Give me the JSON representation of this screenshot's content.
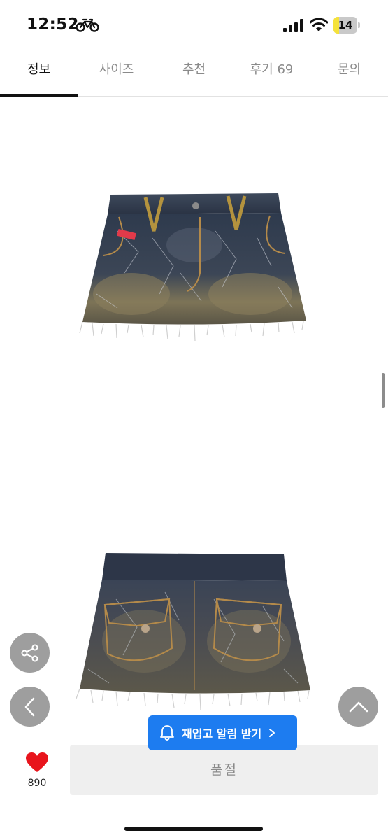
{
  "status_bar": {
    "time": "12:52",
    "battery": "14",
    "battery_level": 0.14,
    "battery_color": "#f5e23b",
    "icons": [
      "bicycle-icon",
      "cellular-signal-icon",
      "wifi-icon",
      "battery-icon"
    ]
  },
  "tabs": [
    {
      "label": "정보",
      "active": true
    },
    {
      "label": "사이즈",
      "active": false
    },
    {
      "label": "추천",
      "active": false
    },
    {
      "label": "후기 69",
      "active": false
    },
    {
      "label": "문의",
      "active": false
    }
  ],
  "product_images": [
    {
      "name": "denim-mini-skirt-front-image"
    },
    {
      "name": "denim-mini-skirt-back-image"
    }
  ],
  "floating_buttons": {
    "share_icon": "share-icon",
    "back_icon": "chevron-left-icon",
    "top_icon": "chevron-up-icon"
  },
  "restock": {
    "label": "재입고 알림 받기",
    "icon": "bell-icon",
    "color": "#1d7cf0"
  },
  "bottom_bar": {
    "like_count": "890",
    "like_color": "#e8141c",
    "soldout_label": "품절"
  }
}
